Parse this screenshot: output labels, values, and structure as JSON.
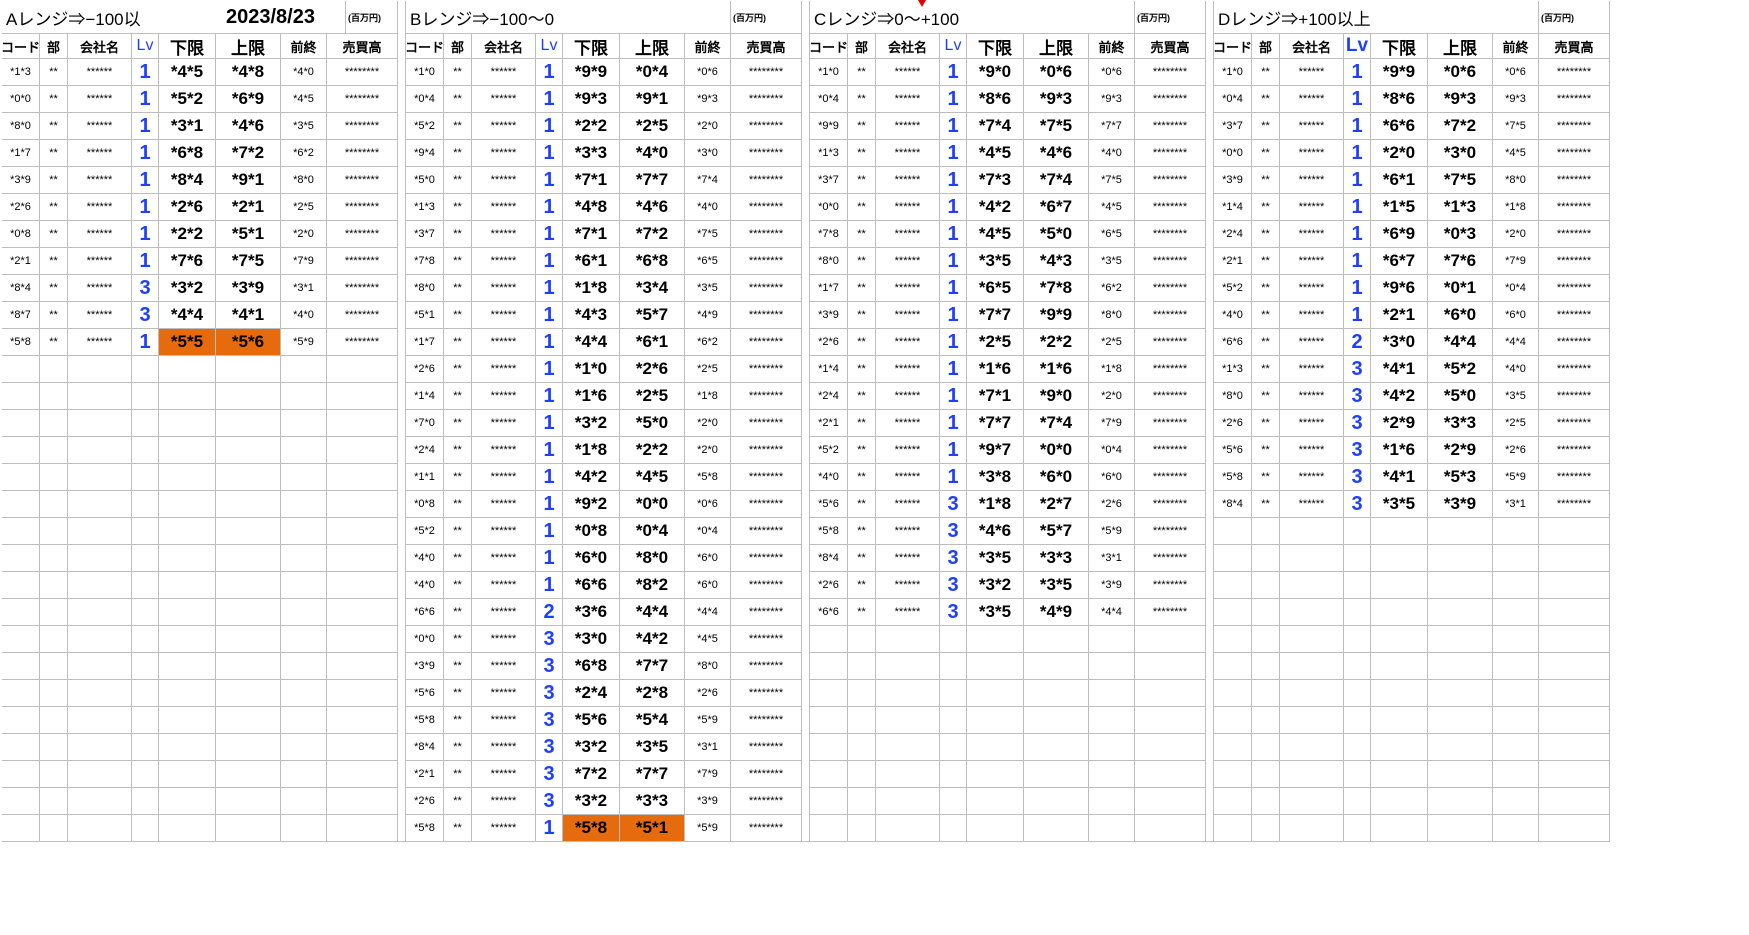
{
  "date": "2023/8/23",
  "units_label": "(百万円)",
  "headers": [
    "コード",
    "部",
    "会社名",
    "Lv",
    "下限",
    "上限",
    "前終",
    "売買高"
  ],
  "highlight_color": "#e56b0c",
  "lv_color": "#1f3fff",
  "sections": [
    {
      "title": "Aレンジ⇒−100以",
      "rows": [
        [
          "*1*3",
          "**",
          "******",
          "1",
          "*4*5",
          "*4*8",
          "*4*0",
          "********"
        ],
        [
          "*0*0",
          "**",
          "******",
          "1",
          "*5*2",
          "*6*9",
          "*4*5",
          "********"
        ],
        [
          "*8*0",
          "**",
          "******",
          "1",
          "*3*1",
          "*4*6",
          "*3*5",
          "********"
        ],
        [
          "*1*7",
          "**",
          "******",
          "1",
          "*6*8",
          "*7*2",
          "*6*2",
          "********"
        ],
        [
          "*3*9",
          "**",
          "******",
          "1",
          "*8*4",
          "*9*1",
          "*8*0",
          "********"
        ],
        [
          "*2*6",
          "**",
          "******",
          "1",
          "*2*6",
          "*2*1",
          "*2*5",
          "********"
        ],
        [
          "*0*8",
          "**",
          "******",
          "1",
          "*2*2",
          "*5*1",
          "*2*0",
          "********"
        ],
        [
          "*2*1",
          "**",
          "******",
          "1",
          "*7*6",
          "*7*5",
          "*7*9",
          "********"
        ],
        [
          "*8*4",
          "**",
          "******",
          "3",
          "*3*2",
          "*3*9",
          "*3*1",
          "********"
        ],
        [
          "*8*7",
          "**",
          "******",
          "3",
          "*4*4",
          "*4*1",
          "*4*0",
          "********"
        ],
        [
          "*5*8",
          "**",
          "******",
          "1",
          "*5*5",
          "*5*6",
          "*5*9",
          "********"
        ]
      ],
      "highlight_row": 10
    },
    {
      "title": "Bレンジ⇒−100〜0",
      "rows": [
        [
          "*1*0",
          "**",
          "******",
          "1",
          "*9*9",
          "*0*4",
          "*0*6",
          "********"
        ],
        [
          "*0*4",
          "**",
          "******",
          "1",
          "*9*3",
          "*9*1",
          "*9*3",
          "********"
        ],
        [
          "*5*2",
          "**",
          "******",
          "1",
          "*2*2",
          "*2*5",
          "*2*0",
          "********"
        ],
        [
          "*9*4",
          "**",
          "******",
          "1",
          "*3*3",
          "*4*0",
          "*3*0",
          "********"
        ],
        [
          "*5*0",
          "**",
          "******",
          "1",
          "*7*1",
          "*7*7",
          "*7*4",
          "********"
        ],
        [
          "*1*3",
          "**",
          "******",
          "1",
          "*4*8",
          "*4*6",
          "*4*0",
          "********"
        ],
        [
          "*3*7",
          "**",
          "******",
          "1",
          "*7*1",
          "*7*2",
          "*7*5",
          "********"
        ],
        [
          "*7*8",
          "**",
          "******",
          "1",
          "*6*1",
          "*6*8",
          "*6*5",
          "********"
        ],
        [
          "*8*0",
          "**",
          "******",
          "1",
          "*1*8",
          "*3*4",
          "*3*5",
          "********"
        ],
        [
          "*5*1",
          "**",
          "******",
          "1",
          "*4*3",
          "*5*7",
          "*4*9",
          "********"
        ],
        [
          "*1*7",
          "**",
          "******",
          "1",
          "*4*4",
          "*6*1",
          "*6*2",
          "********"
        ],
        [
          "*2*6",
          "**",
          "******",
          "1",
          "*1*0",
          "*2*6",
          "*2*5",
          "********"
        ],
        [
          "*1*4",
          "**",
          "******",
          "1",
          "*1*6",
          "*2*5",
          "*1*8",
          "********"
        ],
        [
          "*7*0",
          "**",
          "******",
          "1",
          "*3*2",
          "*5*0",
          "*2*0",
          "********"
        ],
        [
          "*2*4",
          "**",
          "******",
          "1",
          "*1*8",
          "*2*2",
          "*2*0",
          "********"
        ],
        [
          "*1*1",
          "**",
          "******",
          "1",
          "*4*2",
          "*4*5",
          "*5*8",
          "********"
        ],
        [
          "*0*8",
          "**",
          "******",
          "1",
          "*9*2",
          "*0*0",
          "*0*6",
          "********"
        ],
        [
          "*5*2",
          "**",
          "******",
          "1",
          "*0*8",
          "*0*4",
          "*0*4",
          "********"
        ],
        [
          "*4*0",
          "**",
          "******",
          "1",
          "*6*0",
          "*8*0",
          "*6*0",
          "********"
        ],
        [
          "*4*0",
          "**",
          "******",
          "1",
          "*6*6",
          "*8*2",
          "*6*0",
          "********"
        ],
        [
          "*6*6",
          "**",
          "******",
          "2",
          "*3*6",
          "*4*4",
          "*4*4",
          "********"
        ],
        [
          "*0*0",
          "**",
          "******",
          "3",
          "*3*0",
          "*4*2",
          "*4*5",
          "********"
        ],
        [
          "*3*9",
          "**",
          "******",
          "3",
          "*6*8",
          "*7*7",
          "*8*0",
          "********"
        ],
        [
          "*5*6",
          "**",
          "******",
          "3",
          "*2*4",
          "*2*8",
          "*2*6",
          "********"
        ],
        [
          "*5*8",
          "**",
          "******",
          "3",
          "*5*6",
          "*5*4",
          "*5*9",
          "********"
        ],
        [
          "*8*4",
          "**",
          "******",
          "3",
          "*3*2",
          "*3*5",
          "*3*1",
          "********"
        ],
        [
          "*2*1",
          "**",
          "******",
          "3",
          "*7*2",
          "*7*7",
          "*7*9",
          "********"
        ],
        [
          "*2*6",
          "**",
          "******",
          "3",
          "*3*2",
          "*3*3",
          "*3*9",
          "********"
        ],
        [
          "*5*8",
          "**",
          "******",
          "1",
          "*5*8",
          "*5*1",
          "*5*9",
          "********"
        ]
      ],
      "highlight_row": 28
    },
    {
      "title": "Cレンジ⇒0〜+100",
      "rows": [
        [
          "*1*0",
          "**",
          "******",
          "1",
          "*9*0",
          "*0*6",
          "*0*6",
          "********"
        ],
        [
          "*0*4",
          "**",
          "******",
          "1",
          "*8*6",
          "*9*3",
          "*9*3",
          "********"
        ],
        [
          "*9*9",
          "**",
          "******",
          "1",
          "*7*4",
          "*7*5",
          "*7*7",
          "********"
        ],
        [
          "*1*3",
          "**",
          "******",
          "1",
          "*4*5",
          "*4*6",
          "*4*0",
          "********"
        ],
        [
          "*3*7",
          "**",
          "******",
          "1",
          "*7*3",
          "*7*4",
          "*7*5",
          "********"
        ],
        [
          "*0*0",
          "**",
          "******",
          "1",
          "*4*2",
          "*6*7",
          "*4*5",
          "********"
        ],
        [
          "*7*8",
          "**",
          "******",
          "1",
          "*4*5",
          "*5*0",
          "*6*5",
          "********"
        ],
        [
          "*8*0",
          "**",
          "******",
          "1",
          "*3*5",
          "*4*3",
          "*3*5",
          "********"
        ],
        [
          "*1*7",
          "**",
          "******",
          "1",
          "*6*5",
          "*7*8",
          "*6*2",
          "********"
        ],
        [
          "*3*9",
          "**",
          "******",
          "1",
          "*7*7",
          "*9*9",
          "*8*0",
          "********"
        ],
        [
          "*2*6",
          "**",
          "******",
          "1",
          "*2*5",
          "*2*2",
          "*2*5",
          "********"
        ],
        [
          "*1*4",
          "**",
          "******",
          "1",
          "*1*6",
          "*1*6",
          "*1*8",
          "********"
        ],
        [
          "*2*4",
          "**",
          "******",
          "1",
          "*7*1",
          "*9*0",
          "*2*0",
          "********"
        ],
        [
          "*2*1",
          "**",
          "******",
          "1",
          "*7*7",
          "*7*4",
          "*7*9",
          "********"
        ],
        [
          "*5*2",
          "**",
          "******",
          "1",
          "*9*7",
          "*0*0",
          "*0*4",
          "********"
        ],
        [
          "*4*0",
          "**",
          "******",
          "1",
          "*3*8",
          "*6*0",
          "*6*0",
          "********"
        ],
        [
          "*5*6",
          "**",
          "******",
          "3",
          "*1*8",
          "*2*7",
          "*2*6",
          "********"
        ],
        [
          "*5*8",
          "**",
          "******",
          "3",
          "*4*6",
          "*5*7",
          "*5*9",
          "********"
        ],
        [
          "*8*4",
          "**",
          "******",
          "3",
          "*3*5",
          "*3*3",
          "*3*1",
          "********"
        ],
        [
          "*2*6",
          "**",
          "******",
          "3",
          "*3*2",
          "*3*5",
          "*3*9",
          "********"
        ],
        [
          "*6*6",
          "**",
          "******",
          "3",
          "*3*5",
          "*4*9",
          "*4*4",
          "********"
        ]
      ],
      "highlight_row": -1
    },
    {
      "title": "Dレンジ⇒+100以上",
      "rows": [
        [
          "*1*0",
          "**",
          "******",
          "1",
          "*9*9",
          "*0*6",
          "*0*6",
          "********"
        ],
        [
          "*0*4",
          "**",
          "******",
          "1",
          "*8*6",
          "*9*3",
          "*9*3",
          "********"
        ],
        [
          "*3*7",
          "**",
          "******",
          "1",
          "*6*6",
          "*7*2",
          "*7*5",
          "********"
        ],
        [
          "*0*0",
          "**",
          "******",
          "1",
          "*2*0",
          "*3*0",
          "*4*5",
          "********"
        ],
        [
          "*3*9",
          "**",
          "******",
          "1",
          "*6*1",
          "*7*5",
          "*8*0",
          "********"
        ],
        [
          "*1*4",
          "**",
          "******",
          "1",
          "*1*5",
          "*1*3",
          "*1*8",
          "********"
        ],
        [
          "*2*4",
          "**",
          "******",
          "1",
          "*6*9",
          "*0*3",
          "*2*0",
          "********"
        ],
        [
          "*2*1",
          "**",
          "******",
          "1",
          "*6*7",
          "*7*6",
          "*7*9",
          "********"
        ],
        [
          "*5*2",
          "**",
          "******",
          "1",
          "*9*6",
          "*0*1",
          "*0*4",
          "********"
        ],
        [
          "*4*0",
          "**",
          "******",
          "1",
          "*2*1",
          "*6*0",
          "*6*0",
          "********"
        ],
        [
          "*6*6",
          "**",
          "******",
          "2",
          "*3*0",
          "*4*4",
          "*4*4",
          "********"
        ],
        [
          "*1*3",
          "**",
          "******",
          "3",
          "*4*1",
          "*5*2",
          "*4*0",
          "********"
        ],
        [
          "*8*0",
          "**",
          "******",
          "3",
          "*4*2",
          "*5*0",
          "*3*5",
          "********"
        ],
        [
          "*2*6",
          "**",
          "******",
          "3",
          "*2*9",
          "*3*3",
          "*2*5",
          "********"
        ],
        [
          "*5*6",
          "**",
          "******",
          "3",
          "*1*6",
          "*2*9",
          "*2*6",
          "********"
        ],
        [
          "*5*8",
          "**",
          "******",
          "3",
          "*4*1",
          "*5*3",
          "*5*9",
          "********"
        ],
        [
          "*8*4",
          "**",
          "******",
          "3",
          "*3*5",
          "*3*9",
          "*3*1",
          "********"
        ]
      ],
      "highlight_row": -1
    }
  ]
}
